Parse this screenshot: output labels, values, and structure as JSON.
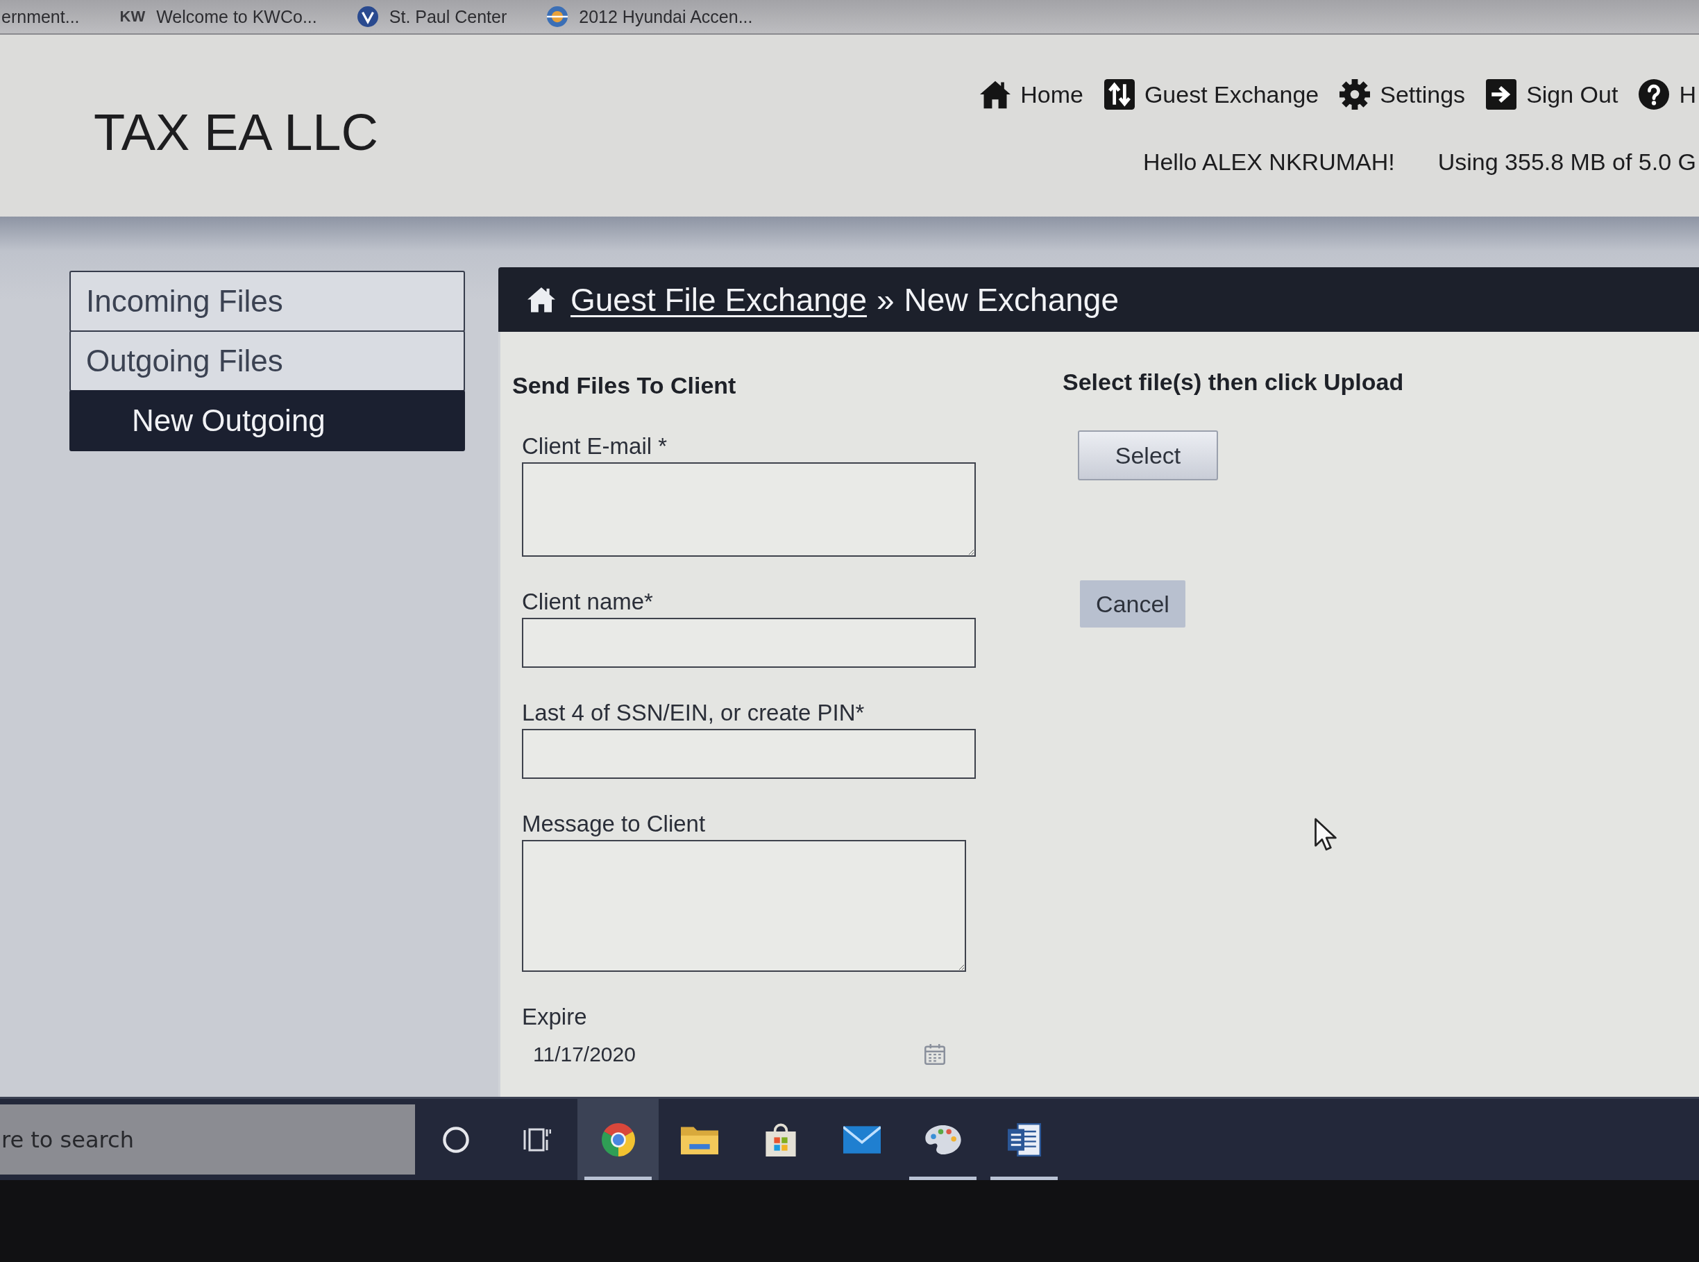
{
  "bookmarks_bar": {
    "items": [
      {
        "label": "ernment..."
      },
      {
        "icon_text": "KW",
        "label": "Welcome to KWCo..."
      },
      {
        "label": "St. Paul Center"
      },
      {
        "label": "2012 Hyundai Accen..."
      }
    ]
  },
  "header": {
    "logo": "TAX EA LLC",
    "nav": [
      {
        "label": "Home"
      },
      {
        "label": "Guest Exchange"
      },
      {
        "label": "Settings"
      },
      {
        "label": "Sign Out"
      },
      {
        "label": "H"
      }
    ],
    "greeting": "Hello ALEX NKRUMAH!",
    "usage": "Using 355.8 MB of 5.0 G"
  },
  "sidebar": {
    "items": [
      {
        "label": "Incoming Files",
        "selected": false
      },
      {
        "label": "Outgoing Files",
        "selected": false,
        "children": [
          {
            "label": "New Outgoing",
            "selected": true
          }
        ]
      }
    ]
  },
  "panel": {
    "breadcrumb": {
      "link": "Guest File Exchange",
      "separator": "»",
      "current": "New Exchange"
    },
    "form": {
      "title": "Send Files To Client",
      "fields": [
        {
          "kind": "textarea",
          "label": "Client E-mail *"
        },
        {
          "kind": "text",
          "label": "Client name*"
        },
        {
          "kind": "text",
          "label": "Last 4 of SSN/EIN, or create PIN*"
        },
        {
          "kind": "textarea",
          "label": "Message to Client"
        },
        {
          "kind": "date",
          "label": "Expire",
          "value": "11/17/2020"
        }
      ]
    },
    "upload": {
      "title": "Select file(s) then click Upload",
      "buttons": [
        {
          "label": "Select",
          "kind": "outlined"
        },
        {
          "label": "Cancel",
          "kind": "filled"
        }
      ]
    }
  },
  "taskbar": {
    "search": {
      "placeholder": "re to search"
    },
    "buttons": [
      {
        "selected": false,
        "running": false
      },
      {
        "selected": false,
        "running": false
      },
      {
        "selected": true,
        "running": true
      },
      {
        "selected": false,
        "running": false
      },
      {
        "selected": false,
        "running": false
      },
      {
        "selected": false,
        "running": false
      },
      {
        "selected": false,
        "running": true
      },
      {
        "selected": false,
        "running": true
      }
    ]
  }
}
